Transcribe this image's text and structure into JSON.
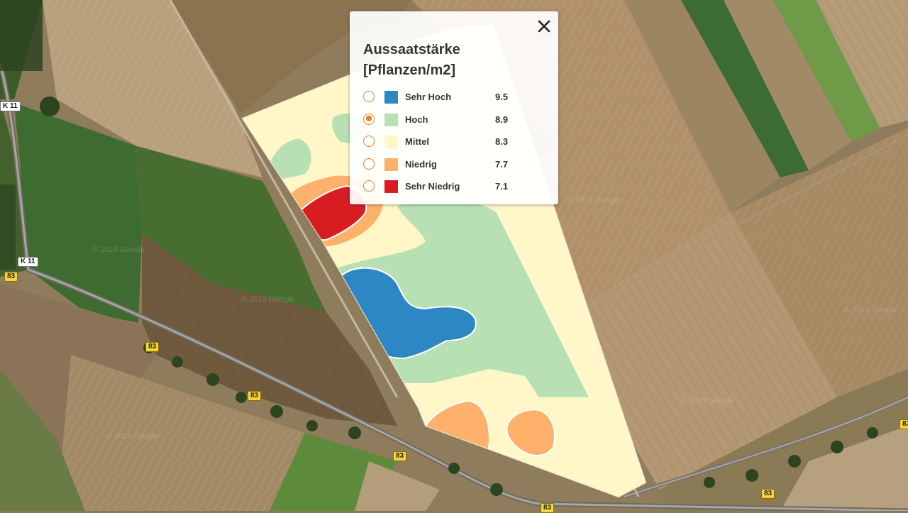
{
  "legend": {
    "title_line1": "Aussaatstärke",
    "title_line2": "[Pflanzen/m2]",
    "selected_index": 1,
    "classes": [
      {
        "label": "Sehr Hoch",
        "value": "9.5",
        "color": "#2e87c5",
        "selected": false
      },
      {
        "label": "Hoch",
        "value": "8.9",
        "color": "#b7e1b4",
        "selected": true
      },
      {
        "label": "Mittel",
        "value": "8.3",
        "color": "#fff7c8",
        "selected": false
      },
      {
        "label": "Niedrig",
        "value": "7.7",
        "color": "#fdb16b",
        "selected": false
      },
      {
        "label": "Sehr Niedrig",
        "value": "7.1",
        "color": "#d81d22",
        "selected": false
      }
    ]
  },
  "roads": {
    "k11_label": "K 11",
    "b83_label": "83"
  },
  "watermark": "© 2019 Google",
  "colors": {
    "accent": "#f07d1d",
    "panel_background": "#ffffff",
    "text": "#333333"
  },
  "icons": {
    "close": "close-icon"
  }
}
